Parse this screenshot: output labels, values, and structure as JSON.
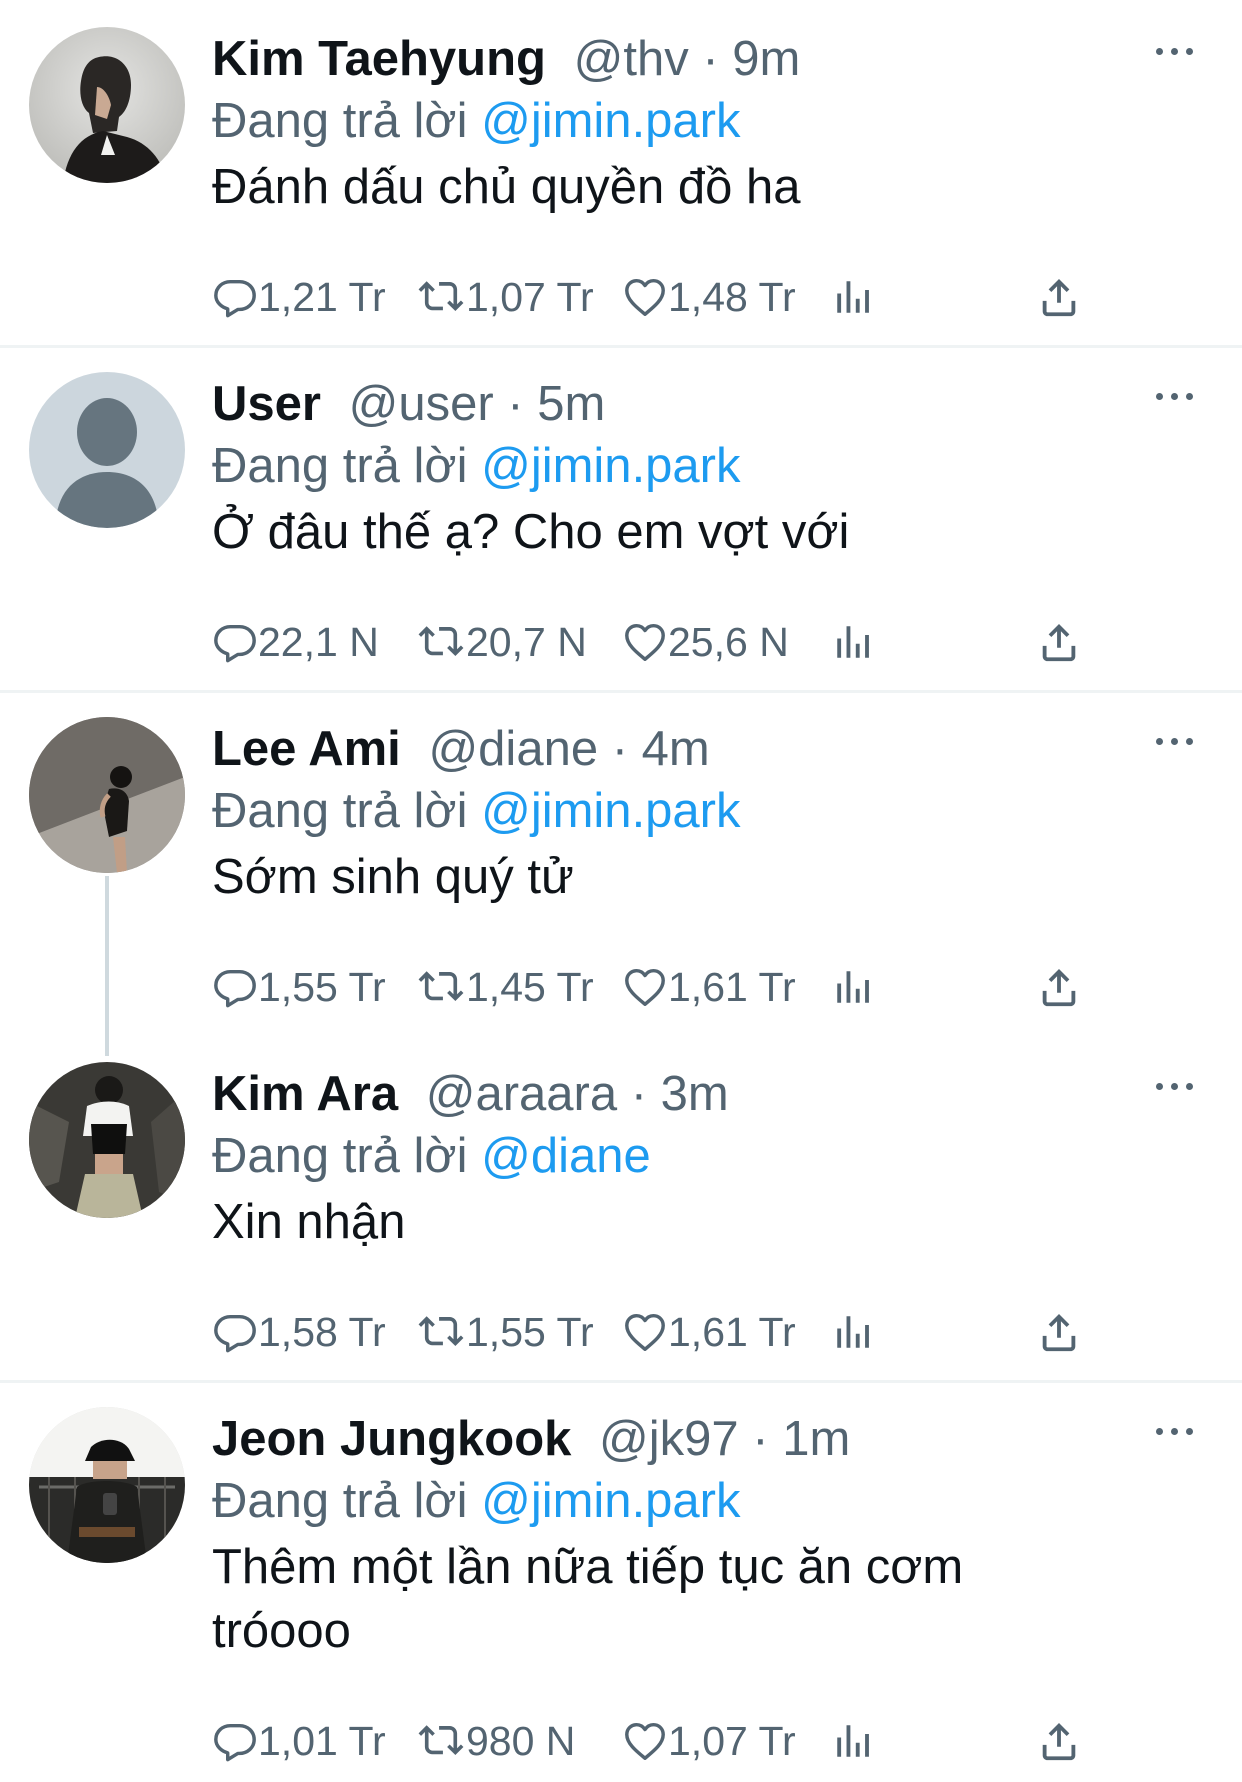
{
  "tweets": [
    {
      "name": "Kim Taehyung",
      "handle": "@thv",
      "time": "9m",
      "reply_prefix": "Đang trả lời",
      "reply_to": "@jimin.park",
      "text": "Đánh dấu chủ quyền đồ ha",
      "replies": "1,21 Tr",
      "retweets": "1,07 Tr",
      "likes": "1,48 Tr"
    },
    {
      "name": "User",
      "handle": "@user",
      "time": "5m",
      "reply_prefix": "Đang trả lời",
      "reply_to": "@jimin.park",
      "text": "Ở đâu thế ạ? Cho em vợt với",
      "replies": "22,1 N",
      "retweets": "20,7 N",
      "likes": "25,6 N"
    },
    {
      "name": "Lee Ami",
      "handle": "@diane",
      "time": "4m",
      "reply_prefix": "Đang trả lời",
      "reply_to": "@jimin.park",
      "text": "Sớm sinh quý tử",
      "replies": "1,55 Tr",
      "retweets": "1,45 Tr",
      "likes": "1,61 Tr"
    },
    {
      "name": "Kim Ara",
      "handle": "@araara",
      "time": "3m",
      "reply_prefix": "Đang trả lời",
      "reply_to": "@diane",
      "text": "Xin nhận",
      "replies": "1,58 Tr",
      "retweets": "1,55 Tr",
      "likes": "1,61 Tr"
    },
    {
      "name": "Jeon Jungkook",
      "handle": "@jk97",
      "time": "1m",
      "reply_prefix": "Đang trả lời",
      "reply_to": "@jimin.park",
      "text": "Thêm một lần nữa tiếp tục ăn cơm tróooo",
      "replies": "1,01 Tr",
      "retweets": "980 N",
      "likes": "1,07 Tr"
    }
  ],
  "icons": {
    "reply": "reply-bubble-icon",
    "retweet": "retweet-icon",
    "like": "heart-icon",
    "views": "bar-chart-icon",
    "share": "share-icon",
    "more": "more-dots-icon"
  },
  "colors": {
    "text": "#0f1419",
    "muted": "#536471",
    "link": "#1d9bf0",
    "divider": "#eff3f4"
  }
}
